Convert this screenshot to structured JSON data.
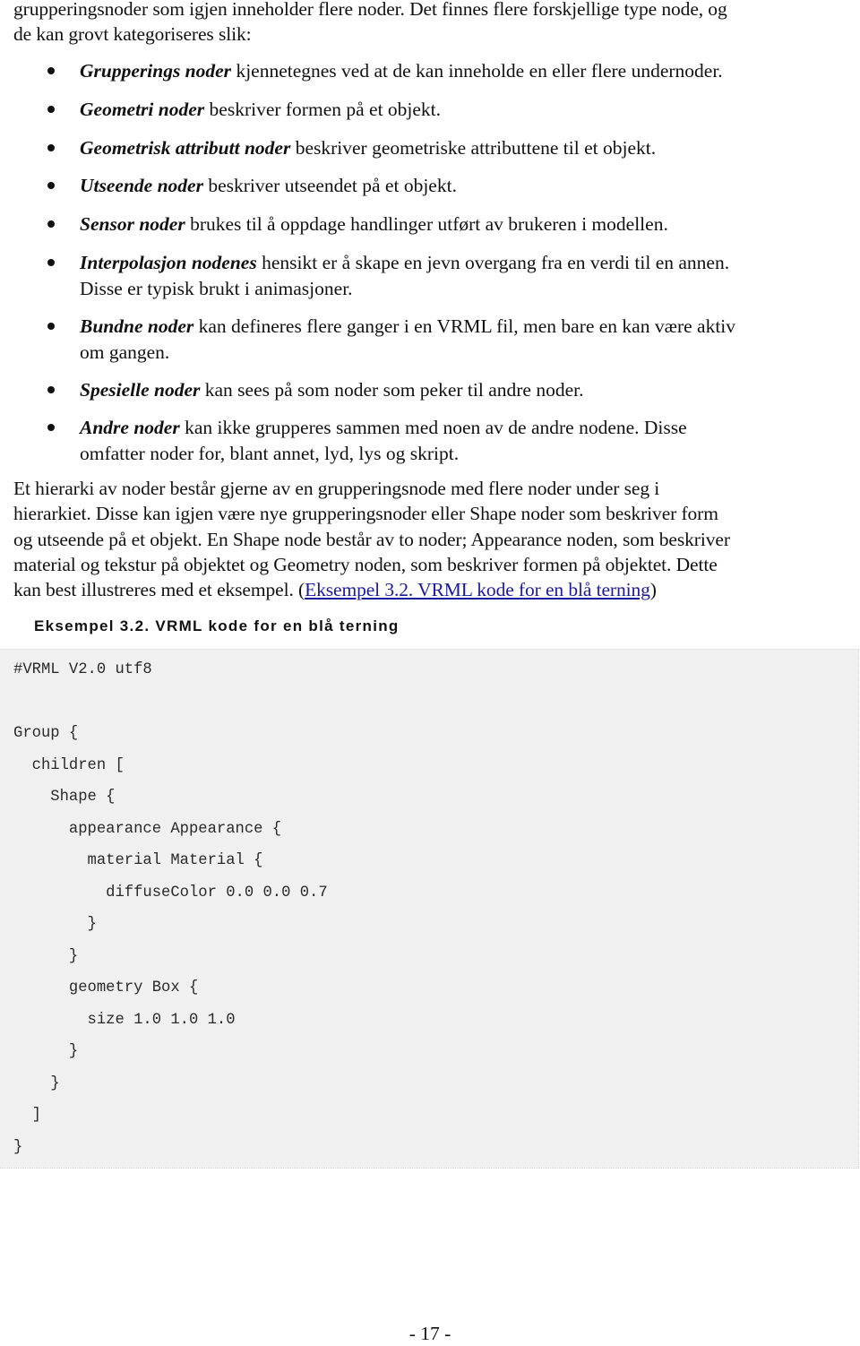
{
  "intro_paragraph": {
    "line1": "grupperingsnoder som igjen inneholder flere noder. Det finnes flere forskjellige type node, og",
    "line2": "de kan grovt kategoriseres slik:"
  },
  "node_types": [
    {
      "term": "Grupperings noder",
      "lines": [
        " kjennetegnes ved at de kan inneholde en eller flere undernoder."
      ]
    },
    {
      "term": "Geometri noder",
      "lines": [
        " beskriver formen på et objekt."
      ]
    },
    {
      "term": "Geometrisk attributt noder",
      "lines": [
        " beskriver geometriske attributtene til et objekt."
      ]
    },
    {
      "term": "Utseende noder",
      "lines": [
        " beskriver utseendet på et objekt."
      ]
    },
    {
      "term": "Sensor noder",
      "lines": [
        " brukes til å oppdage handlinger utført av brukeren i modellen."
      ]
    },
    {
      "term": "Interpolasjon nodenes",
      "lines": [
        " hensikt er å skape en jevn overgang fra en verdi til en annen.",
        "Disse er typisk brukt i animasjoner."
      ]
    },
    {
      "term": "Bundne noder",
      "lines": [
        " kan defineres flere ganger i en VRML fil, men bare en kan være aktiv",
        "om gangen."
      ]
    },
    {
      "term": "Spesielle noder",
      "lines": [
        " kan sees på som noder som peker til andre noder."
      ]
    },
    {
      "term": "Andre noder",
      "lines": [
        " kan ikke grupperes sammen med noen av de andre nodene. Disse",
        "omfatter noder for, blant annet, lyd, lys og skript."
      ]
    }
  ],
  "hierarchy_paragraph": {
    "lines": [
      "Et hierarki av noder består gjerne av en grupperingsnode med flere noder under seg i",
      "hierarkiet. Disse kan igjen være nye grupperingsnoder eller Shape noder som beskriver form",
      "og utseende på et objekt. En Shape node består av to noder; Appearance noden, som beskriver",
      "material og tekstur på objektet og Geometry noden, som beskriver formen på objektet. Dette"
    ],
    "last_line_prefix": "kan best illustreres med et eksempel. (",
    "link_text": "Eksempel 3.2. VRML kode for en blå terning",
    "last_line_suffix": ")"
  },
  "example": {
    "title": "Eksempel 3.2. VRML kode for en blå terning",
    "code_lines": [
      "#VRML V2.0 utf8",
      "",
      "Group {",
      "  children [",
      "    Shape {",
      "      appearance Appearance {",
      "        material Material {",
      "          diffuseColor 0.0 0.0 0.7",
      "        }",
      "      }",
      "      geometry Box {",
      "        size 1.0 1.0 1.0",
      "      }",
      "    }",
      "  ]",
      "}"
    ]
  },
  "page_number": "- 17 -",
  "colors": {
    "link": "#1a1a9c",
    "code_background": "#f0f0f0"
  }
}
